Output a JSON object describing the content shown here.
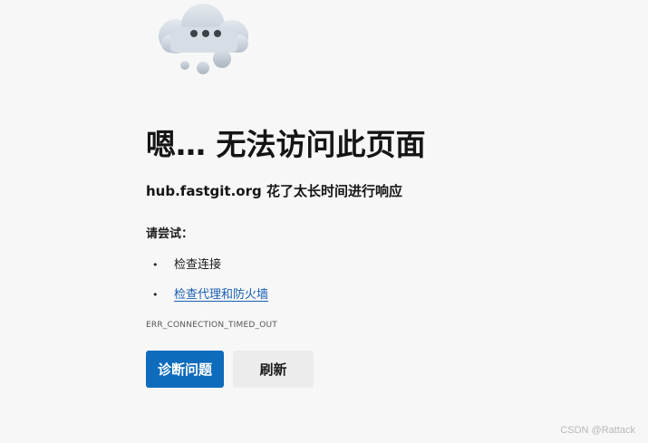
{
  "error_page": {
    "title": "嗯… 无法访问此页面",
    "message": "hub.fastgit.org 花了太长时间进行响应",
    "try_label": "请尝试：",
    "suggestions": [
      {
        "text": "检查连接",
        "is_link": false
      },
      {
        "text": "检查代理和防火墙",
        "is_link": true
      }
    ],
    "error_code": "ERR_CONNECTION_TIMED_OUT",
    "buttons": {
      "diagnose": "诊断问题",
      "refresh": "刷新"
    },
    "illustration": "cloud-with-ellipsis-icon"
  },
  "watermark": "CSDN @Rattack",
  "colors": {
    "background": "#f7f7f7",
    "primary_button": "#0f6cbd",
    "secondary_button": "#ececec",
    "link": "#1a5fb4"
  }
}
